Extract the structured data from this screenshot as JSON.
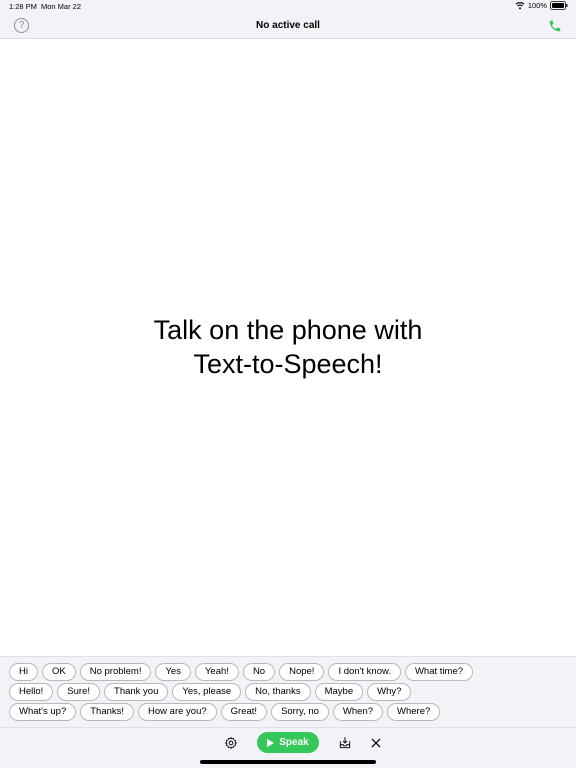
{
  "status_bar": {
    "time": "1:28 PM",
    "date": "Mon Mar 22",
    "battery": "100%"
  },
  "nav": {
    "title": "No active call",
    "help_label": "?",
    "help_icon": "question-circle-icon",
    "call_icon": "phone-icon"
  },
  "main": {
    "headline_line1": "Talk on the phone with",
    "headline_line2": "Text-to-Speech!"
  },
  "phrases": {
    "row0": [
      "Hi",
      "OK",
      "No problem!",
      "Yes",
      "Yeah!",
      "No",
      "Nope!",
      "I don't know.",
      "What time?"
    ],
    "row1": [
      "Hello!",
      "Sure!",
      "Thank you",
      "Yes, please",
      "No, thanks",
      "Maybe",
      "Why?"
    ],
    "row2": [
      "What's up?",
      "Thanks!",
      "How are you?",
      "Great!",
      "Sorry, no",
      "When?",
      "Where?"
    ]
  },
  "toolbar": {
    "speak_label": "Speak",
    "settings_icon": "gear-icon",
    "download_icon": "tray-download-icon",
    "close_icon": "close-icon"
  },
  "colors": {
    "accent": "#34c759",
    "bar_background": "#f2f2f7"
  }
}
